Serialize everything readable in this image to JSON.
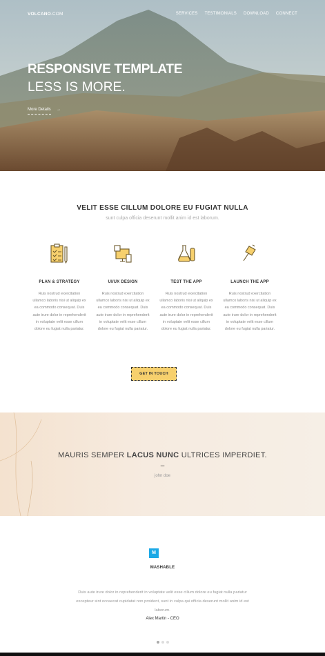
{
  "header": {
    "logo_bold": "VOLCANO",
    "logo_light": ".COM",
    "nav": [
      "SERVICES",
      "TESTIMONIALS",
      "DOWNLOAD",
      "CONNECT"
    ]
  },
  "hero": {
    "title": "RESPONSIVE TEMPLATE",
    "subtitle": "LESS IS MORE.",
    "link": "More Details",
    "link_arrow": "→"
  },
  "services": {
    "title": "VELIT ESSE CILLUM DOLORE EU FUGIAT NULLA",
    "subtitle": "sunt culpa officia deserunt mollit anim id est laborum.",
    "items": [
      {
        "icon": "clipboard-pencil-icon",
        "title": "PLAN & STRATEGY",
        "text": "Ruis nostrud exercitation ullamco laboris nisi ut aliquip ex ea commodo consequat. Duis aute irure dolor in reprehenderit in voluptate velit esse cillum dolore eu fugiat nulla pariatur."
      },
      {
        "icon": "devices-icon",
        "title": "UI/UX DESIGN",
        "text": "Ruis nostrud exercitation ullamco laboris nisi ut aliquip ex ea commodo consequat. Duis aute irure dolor in reprehenderit in voluptate velit esse cillum dolore eu fugiat nulla pariatur."
      },
      {
        "icon": "flask-icon",
        "title": "TEST THE APP",
        "text": "Ruis nostrud exercitation ullamco laboris nisi ut aliquip ex ea commodo consequat. Duis aute irure dolor in reprehenderit in voluptate velit esse cillum dolore eu fugiat nulla pariatur."
      },
      {
        "icon": "flag-icon",
        "title": "LAUNCH THE APP",
        "text": "Ruis nostrud exercitation ullamco laboris nisi ut aliquip ex ea commodo consequat. Duis aute irure dolor in reprehenderit in voluptate velit esse cillum dolore eu fugiat nulla pariatur."
      }
    ],
    "button": "GET IN TOUCH"
  },
  "quote": {
    "pre": "MAURIS SEMPER ",
    "bold": "LACUS NUNC",
    "post": " ULTRICES IMPERDIET.",
    "dash": "–",
    "author": "john doe"
  },
  "testimonial": {
    "logo_letter": "M",
    "company": "MASHABLE",
    "text": "Duis aute irure dolor in reprehenderit in voluptate velit esse cillum dolore eu fugiat nulla pariatur excepteur sint occaecat cupidatat non proident, sunt in culpa qui officia deserunt mollit anim id est laborum.",
    "author": "Alex Martin - CEO",
    "slides": 3,
    "active_slide": 1
  },
  "colors": {
    "accent": "#f7d06d",
    "icon_stroke": "#e0a63a",
    "mashable_blue": "#1ca9e6"
  }
}
